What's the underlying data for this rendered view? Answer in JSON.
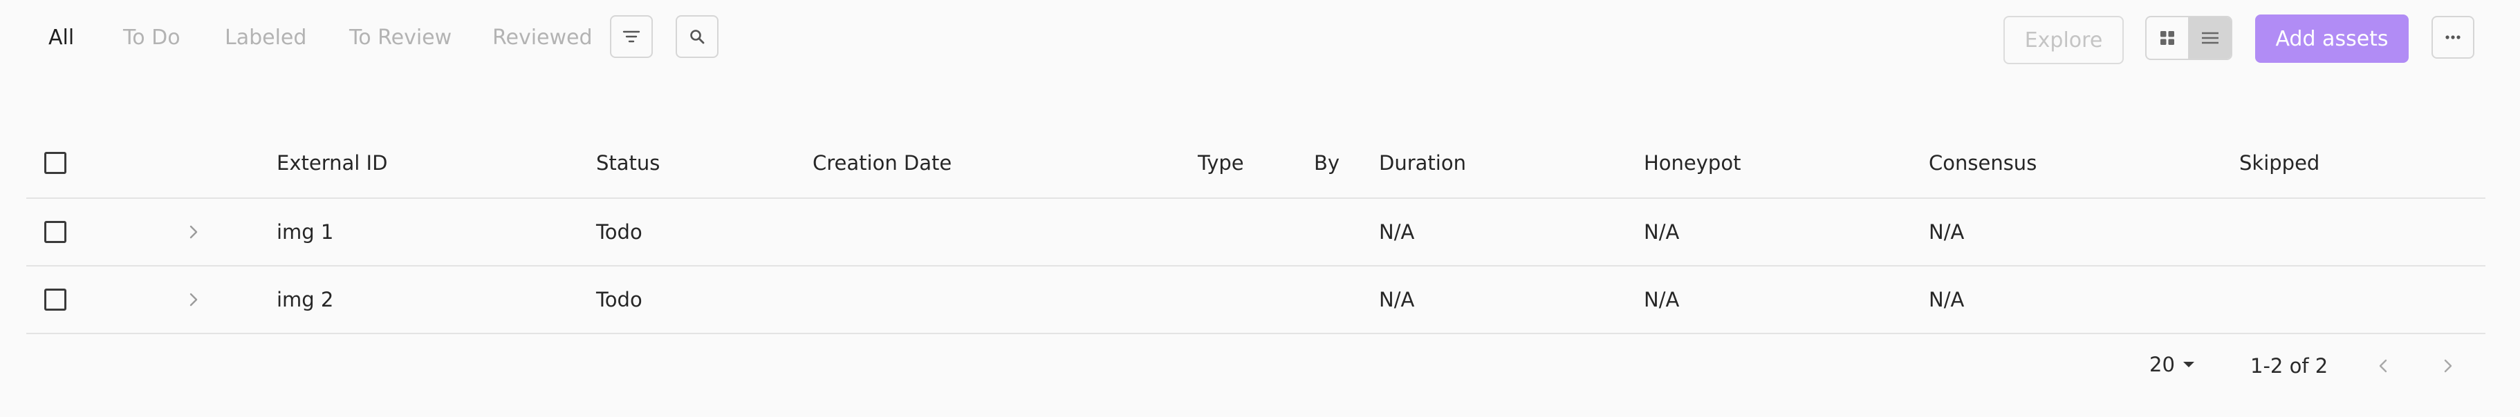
{
  "tabs": [
    {
      "label": "All",
      "active": true
    },
    {
      "label": "To Do",
      "active": false
    },
    {
      "label": "Labeled",
      "active": false
    },
    {
      "label": "To Review",
      "active": false
    },
    {
      "label": "Reviewed",
      "active": false
    }
  ],
  "toolbar": {
    "filter_icon": "filter-icon",
    "search_icon": "search-icon",
    "explore_label": "Explore",
    "grid_view_icon": "grid-view-icon",
    "list_view_icon": "list-view-icon",
    "add_assets_label": "Add assets",
    "more_icon": "more-options-icon",
    "accent_color": "#b18cf5"
  },
  "table": {
    "columns": [
      "External ID",
      "Status",
      "Creation Date",
      "Type",
      "By",
      "Duration",
      "Honeypot",
      "Consensus",
      "Skipped"
    ],
    "rows": [
      {
        "external_id": "img 1",
        "status": "Todo",
        "creation_date": "",
        "type": "",
        "by": "",
        "duration": "N/A",
        "honeypot": "N/A",
        "consensus": "N/A",
        "skipped": ""
      },
      {
        "external_id": "img 2",
        "status": "Todo",
        "creation_date": "",
        "type": "",
        "by": "",
        "duration": "N/A",
        "honeypot": "N/A",
        "consensus": "N/A",
        "skipped": ""
      }
    ]
  },
  "pagination": {
    "page_size": "20",
    "range": "1-2 of 2"
  }
}
